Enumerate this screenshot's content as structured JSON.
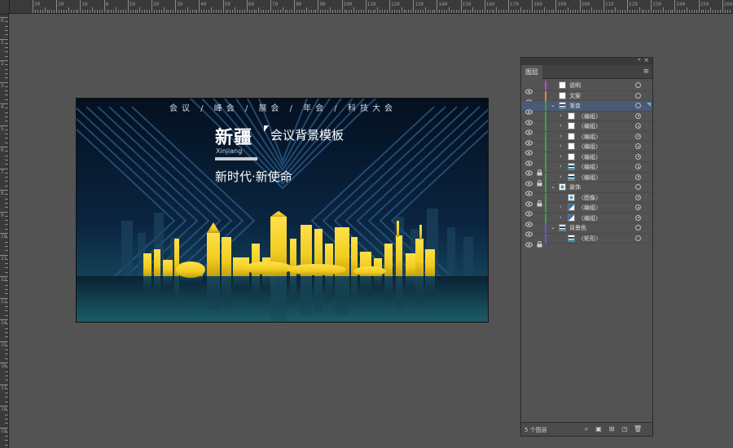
{
  "rulers": {
    "top_labels": [
      "30",
      "20",
      "10",
      "0",
      "10",
      "20",
      "30",
      "40",
      "50",
      "60",
      "70",
      "80",
      "90",
      "100",
      "110",
      "120",
      "130",
      "140",
      "150",
      "160",
      "170",
      "180",
      "190",
      "200",
      "210",
      "220",
      "230",
      "240",
      "250",
      "260",
      "270",
      "280"
    ],
    "left_labels": [
      "0",
      "1",
      "2",
      "3",
      "4",
      "5",
      "6",
      "7",
      "8",
      "9",
      "10",
      "11",
      "12",
      "13",
      "14",
      "15",
      "16",
      "17",
      "18",
      "19",
      "20"
    ]
  },
  "artboard": {
    "nav_text": "会议 / 峰会 / 展会 / 年会 / 科技大会",
    "title_cn": "新疆",
    "title_en": "Xinjiang",
    "subtitle": "会议背景模板",
    "slogan": "新时代·新使命",
    "colors": {
      "bg_dark": "#04101f",
      "bg_teal": "#1a6b73",
      "gold": "#f2cc1f",
      "stripe": "#2c5a8c"
    }
  },
  "layers_panel": {
    "tab_label": "图层",
    "layer_count_text": "5 个图层",
    "layers": [
      {
        "name": "说明",
        "indent": 0,
        "chevron": "",
        "color": "#cc3fd1",
        "eye": true,
        "lock": false,
        "thumb": "white",
        "selected": false,
        "target_filled": false
      },
      {
        "name": "文案",
        "indent": 0,
        "chevron": "",
        "color": "#e08a2b",
        "eye": true,
        "lock": false,
        "thumb": "white",
        "selected": false,
        "target_filled": false
      },
      {
        "name": "渐变",
        "indent": 0,
        "chevron": "v",
        "color": "#3ea33e",
        "eye": true,
        "lock": false,
        "thumb": "stripes",
        "selected": true,
        "target_filled": false
      },
      {
        "name": "〈编组〉",
        "indent": 1,
        "chevron": ">",
        "color": "#3ea33e",
        "eye": true,
        "lock": false,
        "thumb": "white",
        "selected": false,
        "target_filled": true
      },
      {
        "name": "〈编组〉",
        "indent": 1,
        "chevron": ">",
        "color": "#3ea33e",
        "eye": true,
        "lock": false,
        "thumb": "white",
        "selected": false,
        "target_filled": true
      },
      {
        "name": "〈编组〉",
        "indent": 1,
        "chevron": ">",
        "color": "#3ea33e",
        "eye": true,
        "lock": false,
        "thumb": "white",
        "selected": false,
        "target_filled": true
      },
      {
        "name": "〈编组〉",
        "indent": 1,
        "chevron": ">",
        "color": "#3ea33e",
        "eye": true,
        "lock": false,
        "thumb": "white",
        "selected": false,
        "target_filled": true
      },
      {
        "name": "〈编组〉",
        "indent": 1,
        "chevron": ">",
        "color": "#3ea33e",
        "eye": true,
        "lock": false,
        "thumb": "white",
        "selected": false,
        "target_filled": true
      },
      {
        "name": "〈编组〉",
        "indent": 1,
        "chevron": ">",
        "color": "#3ea33e",
        "eye": true,
        "lock": true,
        "thumb": "stripes",
        "selected": false,
        "target_filled": true
      },
      {
        "name": "〈编组〉",
        "indent": 1,
        "chevron": ">",
        "color": "#3ea33e",
        "eye": true,
        "lock": true,
        "thumb": "stripes",
        "selected": false,
        "target_filled": true
      },
      {
        "name": "装饰",
        "indent": 0,
        "chevron": "v",
        "color": "#3ea33e",
        "eye": true,
        "lock": false,
        "thumb": "globe",
        "selected": false,
        "target_filled": false
      },
      {
        "name": "〈图像〉",
        "indent": 1,
        "chevron": "",
        "color": "#3ea33e",
        "eye": true,
        "lock": true,
        "thumb": "globe",
        "selected": false,
        "target_filled": true
      },
      {
        "name": "〈编组〉",
        "indent": 1,
        "chevron": ">",
        "color": "#3ea33e",
        "eye": true,
        "lock": false,
        "thumb": "blueshape",
        "selected": false,
        "target_filled": true
      },
      {
        "name": "〈编组〉",
        "indent": 1,
        "chevron": ">",
        "color": "#3ea33e",
        "eye": true,
        "lock": false,
        "thumb": "blueshape",
        "selected": false,
        "target_filled": true
      },
      {
        "name": "背景色",
        "indent": 0,
        "chevron": "v",
        "color": "#5b5bd6",
        "eye": true,
        "lock": false,
        "thumb": "stripes",
        "selected": false,
        "target_filled": false
      },
      {
        "name": "〈矩形〉",
        "indent": 1,
        "chevron": "",
        "color": "#5b5bd6",
        "eye": true,
        "lock": true,
        "thumb": "stripes",
        "selected": false,
        "target_filled": false
      }
    ],
    "footer_icons": [
      "search-icon",
      "clipping-mask-icon",
      "new-sublayer-icon",
      "new-layer-icon",
      "trash-icon"
    ]
  }
}
